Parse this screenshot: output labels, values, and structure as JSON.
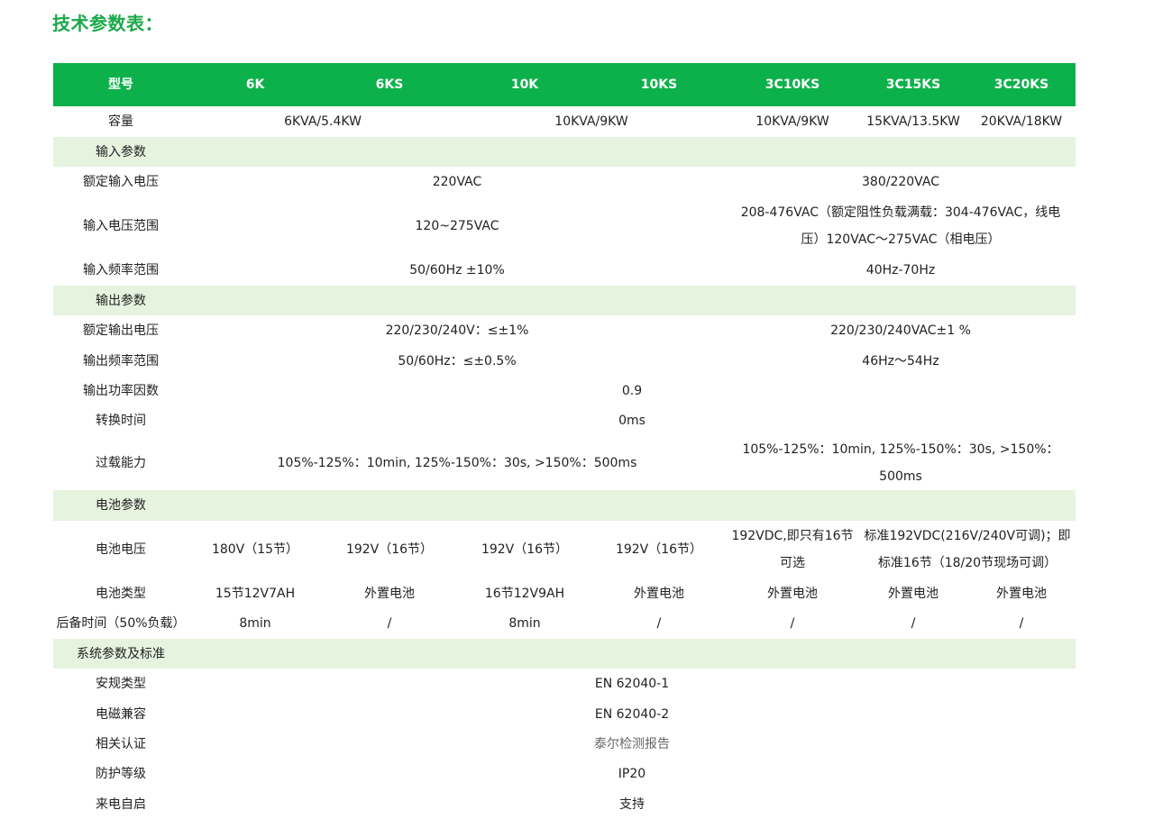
{
  "title": "技术参数表：",
  "headers": [
    "型号",
    "6K",
    "6KS",
    "10K",
    "10KS",
    "3C10KS",
    "3C15KS",
    "3C20KS"
  ],
  "rows": {
    "capacity": {
      "label": "容量",
      "a": "6KVA/5.4KW",
      "b": "10KVA/9KW",
      "c": "10KVA/9KW",
      "d": "15KVA/13.5KW",
      "e": "20KVA/18KW"
    },
    "input_section": "输入参数",
    "input_voltage": {
      "label": "额定输入电压",
      "a": "220VAC",
      "b": "380/220VAC"
    },
    "input_range": {
      "label": "输入电压范围",
      "a": "120~275VAC",
      "b1": "208-476VAC（额定阻性负载满载：304-476VAC，线电",
      "b2": "压）120VAC～275VAC（相电压）"
    },
    "input_freq": {
      "label": "输入频率范围",
      "a": "50/60Hz ±10%",
      "b": "40Hz-70Hz"
    },
    "output_section": "输出参数",
    "output_voltage": {
      "label": "额定输出电压",
      "a": "220/230/240V：≤±1%",
      "b": "220/230/240VAC±1 %"
    },
    "output_freq": {
      "label": "输出频率范围",
      "a": "50/60Hz：≤±0.5%",
      "b": "46Hz～54Hz"
    },
    "power_factor": {
      "label": "输出功率因数",
      "a": "0.9"
    },
    "transfer_time": {
      "label": "转换时间",
      "a": "0ms"
    },
    "overload": {
      "label": "过载能力",
      "a": "105%-125%：10min, 125%-150%：30s, >150%：500ms",
      "b": "105%-125%：10min, 125%-150%：30s, >150%：500ms"
    },
    "battery_section": "电池参数",
    "battery_voltage": {
      "label": "电池电压",
      "c1": "180V（15节）",
      "c2": "192V（16节）",
      "c3": "192V（16节）",
      "c4": "192V（16节）",
      "c5a": "192VDC,即只有16节",
      "c5b": "可选",
      "c6a": "标准192VDC(216V/240V可调)；即",
      "c6b": "标准16节（18/20节现场可调）"
    },
    "battery_type": {
      "label": "电池类型",
      "c1": "15节12V7AH",
      "c2": "外置电池",
      "c3": "16节12V9AH",
      "c4": "外置电池",
      "c5": "外置电池",
      "c6": "外置电池",
      "c7": "外置电池"
    },
    "backup_time": {
      "label": "后备时间（50%负载）",
      "c1": "8min",
      "c2": "/",
      "c3": "8min",
      "c4": "/",
      "c5": "/",
      "c6": "/",
      "c7": "/"
    },
    "system_section": "系统参数及标准",
    "safety": {
      "label": "安规类型",
      "a": "EN 62040-1"
    },
    "emc": {
      "label": "电磁兼容",
      "a": "EN 62040-2"
    },
    "certification": {
      "label": "相关认证",
      "a": "泰尔检测报告"
    },
    "protection": {
      "label": "防护等级",
      "a": "IP20"
    },
    "auto_restart": {
      "label": "来电自启",
      "a": "支持"
    }
  }
}
